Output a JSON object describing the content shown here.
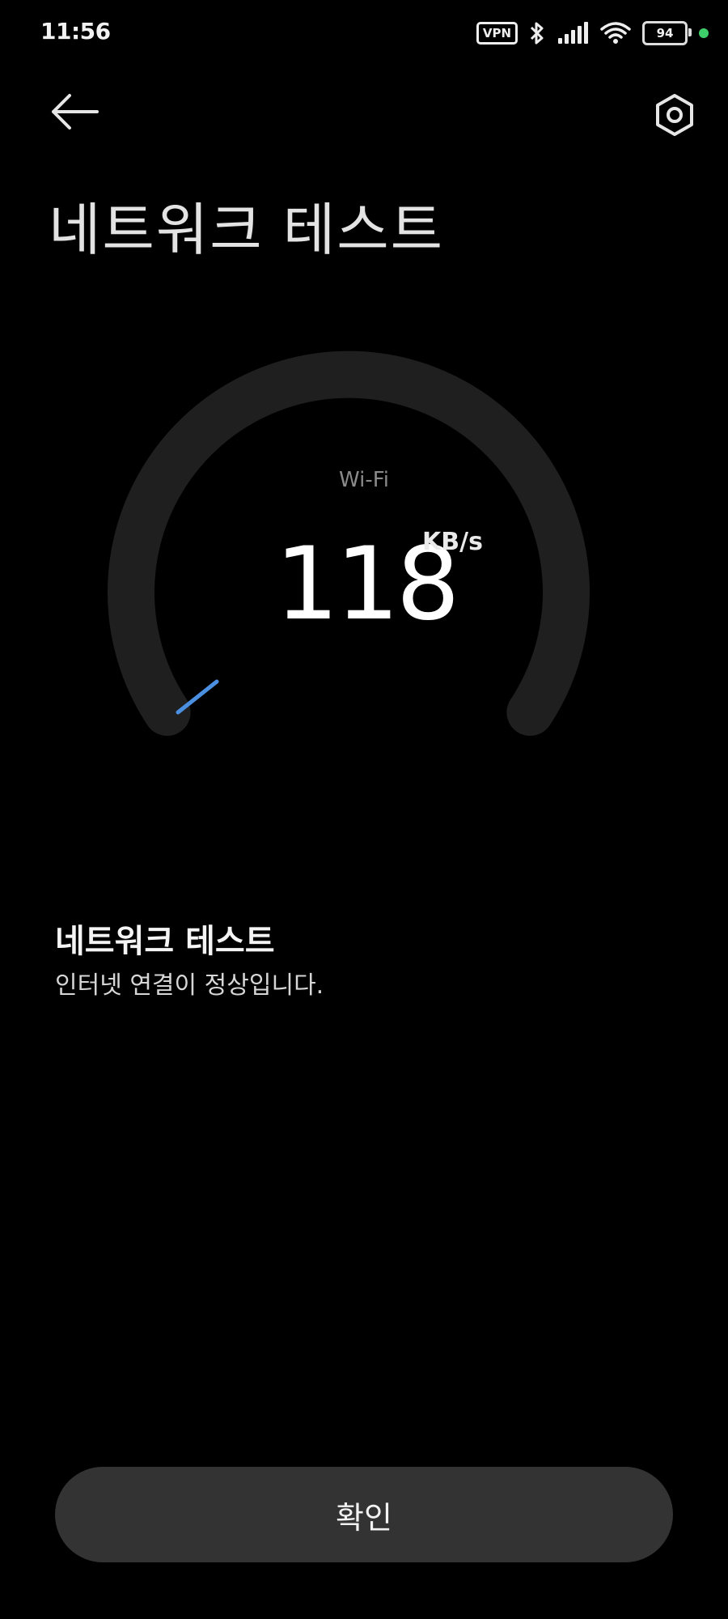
{
  "status_bar": {
    "time": "11:56",
    "vpn_label": "VPN",
    "battery_level": "94",
    "icons": [
      "vpn-icon",
      "bluetooth-icon",
      "signal-icon",
      "wifi-icon",
      "battery-icon",
      "status-dot"
    ]
  },
  "header": {
    "back_icon": "back-arrow-icon",
    "settings_icon": "settings-hexagon-icon",
    "title": "네트워크 테스트"
  },
  "gauge": {
    "network_type": "Wi-Fi",
    "speed_value": "118",
    "speed_unit": "KB/s",
    "track_color": "#1f1f1f",
    "indicator_color": "#4a8fe0"
  },
  "result": {
    "title": "네트워크 테스트",
    "description": "인터넷 연결이 정상입니다."
  },
  "actions": {
    "confirm_label": "확인",
    "button_color": "#333333"
  }
}
